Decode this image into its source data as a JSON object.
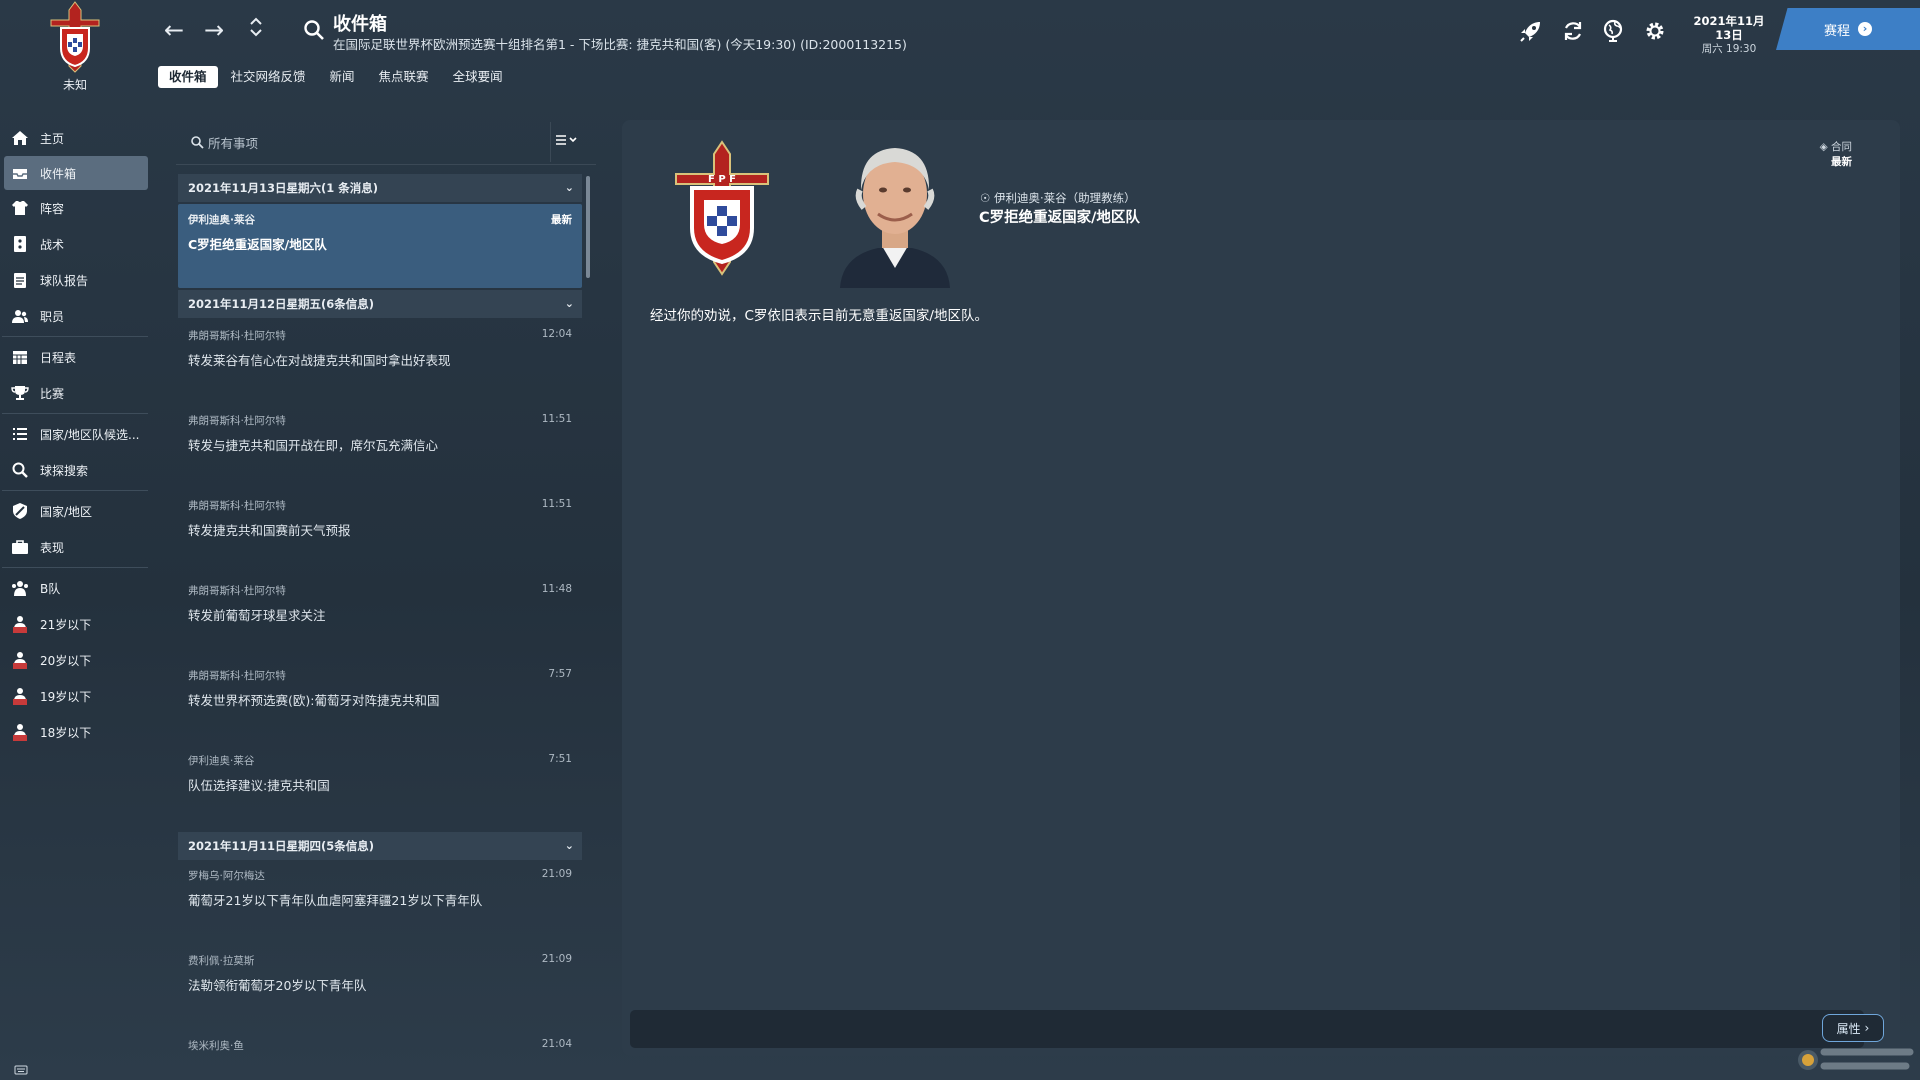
{
  "club": {
    "name": "未知"
  },
  "header": {
    "title": "收件箱",
    "subtitle": "在国际足联世界杯欧洲预选赛十组排名第1 - 下场比赛: 捷克共和国(客) (今天19:30) (ID:2000113215)"
  },
  "tabs": [
    {
      "label": "收件箱",
      "active": true
    },
    {
      "label": "社交网络反馈"
    },
    {
      "label": "新闻"
    },
    {
      "label": "焦点联赛"
    },
    {
      "label": "全球要闻"
    }
  ],
  "date": {
    "line1": "2021年11月13日",
    "line2": "周六 19:30"
  },
  "continue_button": {
    "label": "赛程"
  },
  "sidebar": {
    "items": [
      {
        "label": "主页",
        "icon": "home-icon"
      },
      {
        "label": "收件箱",
        "icon": "inbox-icon",
        "active": true
      },
      {
        "label": "阵容",
        "icon": "shirt-icon"
      },
      {
        "label": "战术",
        "icon": "tactics-icon"
      },
      {
        "label": "球队报告",
        "icon": "clipboard-icon"
      },
      {
        "label": "职员",
        "icon": "staff-icon"
      },
      {
        "label": "日程表",
        "icon": "calendar-icon"
      },
      {
        "label": "比赛",
        "icon": "trophy-icon"
      },
      {
        "label": "国家/地区队候选...",
        "icon": "list-icon"
      },
      {
        "label": "球探搜索",
        "icon": "search-icon"
      },
      {
        "label": "国家/地区",
        "icon": "shield-icon"
      },
      {
        "label": "表现",
        "icon": "briefcase-icon"
      },
      {
        "label": "B队",
        "icon": "team-icon"
      },
      {
        "label": "21岁以下",
        "icon": "youth-team-icon"
      },
      {
        "label": "20岁以下",
        "icon": "youth-team-icon"
      },
      {
        "label": "19岁以下",
        "icon": "youth-team-icon"
      },
      {
        "label": "18岁以下",
        "icon": "youth-team-icon"
      }
    ]
  },
  "list": {
    "search_placeholder": "所有事项",
    "groups": [
      {
        "header": "2021年11月13日星期六(1 条消息)",
        "messages": [
          {
            "sender": "伊利迪奥·莱谷",
            "subject": "C罗拒绝重返国家/地区队",
            "time": "最新",
            "selected": true
          }
        ]
      },
      {
        "header": "2021年11月12日星期五(6条信息)",
        "messages": [
          {
            "sender": "弗朗哥斯科·杜阿尔特",
            "subject": "转发莱谷有信心在对战捷克共和国时拿出好表现",
            "time": "12:04"
          },
          {
            "sender": "弗朗哥斯科·杜阿尔特",
            "subject": "转发与捷克共和国开战在即，席尔瓦充满信心",
            "time": "11:51"
          },
          {
            "sender": "弗朗哥斯科·杜阿尔特",
            "subject": "转发捷克共和国赛前天气预报",
            "time": "11:51"
          },
          {
            "sender": "弗朗哥斯科·杜阿尔特",
            "subject": "转发前葡萄牙球星求关注",
            "time": "11:48"
          },
          {
            "sender": "弗朗哥斯科·杜阿尔特",
            "subject": "转发世界杯预选赛(欧):葡萄牙对阵捷克共和国",
            "time": "7:57"
          },
          {
            "sender": "伊利迪奥·莱谷",
            "subject": "队伍选择建议:捷克共和国",
            "time": "7:51"
          }
        ]
      },
      {
        "header": "2021年11月11日星期四(5条信息)",
        "messages": [
          {
            "sender": "罗梅乌·阿尔梅达",
            "subject": "葡萄牙21岁以下青年队血虐阿塞拜疆21岁以下青年队",
            "time": "21:09"
          },
          {
            "sender": "费利佩·拉莫斯",
            "subject": "法勒领衔葡萄牙20岁以下青年队",
            "time": "21:09"
          },
          {
            "sender": "埃米利奥·鱼",
            "subject": "",
            "time": "21:04"
          }
        ]
      }
    ]
  },
  "detail": {
    "sender": "伊利迪奥·莱谷（助理教练）",
    "subject": "C罗拒绝重返国家/地区队",
    "body": "经过你的劝说，C罗依旧表示目前无意重返国家/地区队。",
    "contract_label": "合同",
    "contract_status": "最新",
    "badge_text": "F P F"
  },
  "attributes_button": {
    "label": "属性"
  },
  "colors": {
    "accent": "#3d7fc6",
    "selected_row": "#3a5d7e",
    "panel": "#2d3c4a"
  }
}
